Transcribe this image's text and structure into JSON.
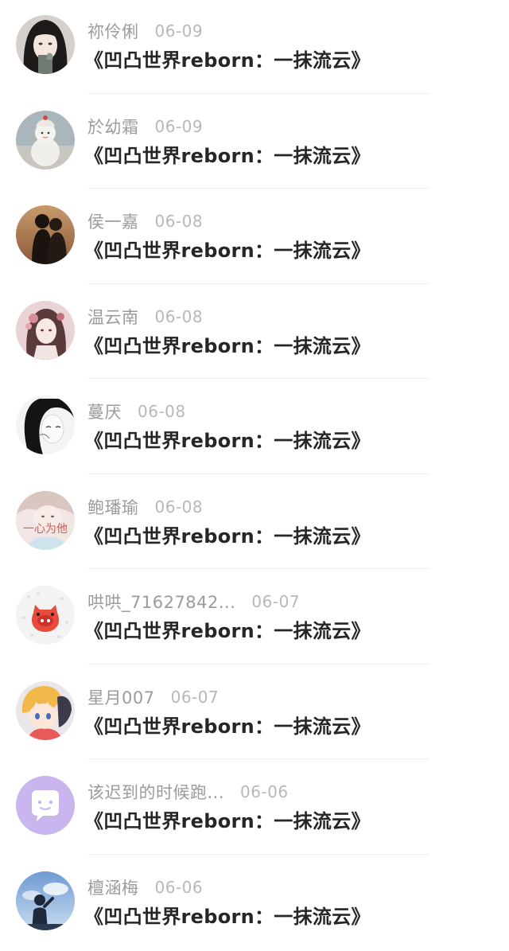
{
  "messages": [
    {
      "name": "祢伶俐",
      "date": "06-09",
      "title": "《凹凸世界reborn：一抹流云》",
      "avatar": "girl-dark-hair-avatar"
    },
    {
      "name": "於幼霜",
      "date": "06-09",
      "title": "《凹凸世界reborn：一抹流云》",
      "avatar": "snowman-toy-avatar"
    },
    {
      "name": "侯一嘉",
      "date": "06-08",
      "title": "《凹凸世界reborn：一抹流云》",
      "avatar": "couple-sunset-avatar"
    },
    {
      "name": "温云南",
      "date": "06-08",
      "title": "《凹凸世界reborn：一抹流云》",
      "avatar": "anime-girl-flowers-avatar"
    },
    {
      "name": "蔓厌",
      "date": "06-08",
      "title": "《凹凸世界reborn：一抹流云》",
      "avatar": "sketch-girl-avatar"
    },
    {
      "name": "鲍璠瑜",
      "date": "06-08",
      "title": "《凹凸世界reborn：一抹流云》",
      "avatar": "girl-text-avatar",
      "avatar_text": "一心为他"
    },
    {
      "name": "哄哄_71627842...",
      "date": "06-07",
      "title": "《凹凸世界reborn：一抹流云》",
      "avatar": "red-pig-avatar"
    },
    {
      "name": "星月007",
      "date": "06-07",
      "title": "《凹凸世界reborn：一抹流云》",
      "avatar": "anime-blonde-avatar"
    },
    {
      "name": "该迟到的时候跑...",
      "date": "06-06",
      "title": "《凹凸世界reborn：一抹流云》",
      "avatar": "default-chat-avatar"
    },
    {
      "name": "檀涵梅",
      "date": "06-06",
      "title": "《凹凸世界reborn：一抹流云》",
      "avatar": "sky-silhouette-avatar"
    }
  ],
  "colors": {
    "name": "#9b9b9b",
    "date": "#b8b8b8",
    "title": "#262626",
    "default_avatar_bg": "#c9b6ee"
  }
}
